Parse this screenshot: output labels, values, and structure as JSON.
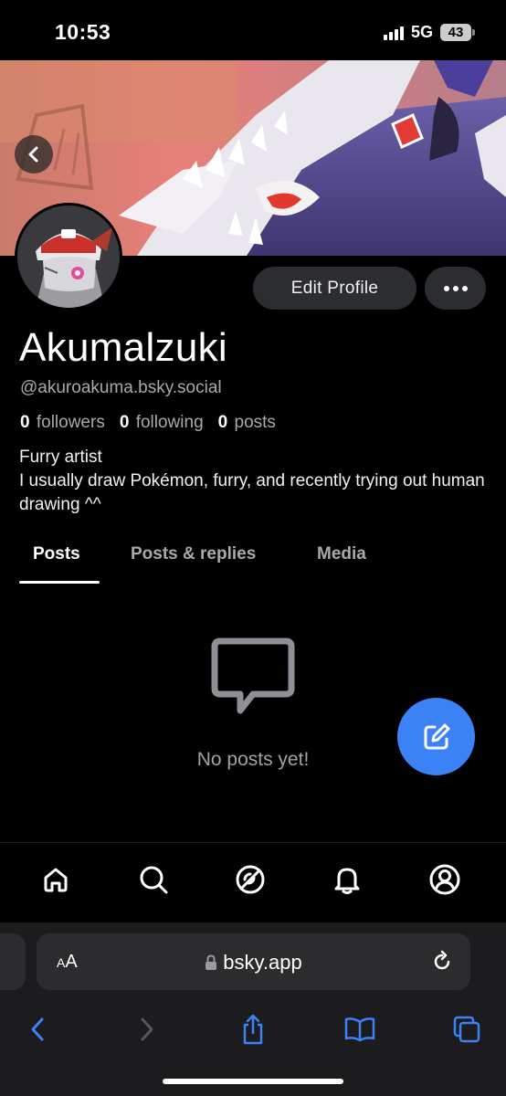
{
  "status_bar": {
    "time": "10:53",
    "network": "5G",
    "battery": "43"
  },
  "profile": {
    "display_name": "Akumalzuki",
    "handle": "@akuroakuma.bsky.social",
    "followers_count": "0",
    "followers_label": "followers",
    "following_count": "0",
    "following_label": "following",
    "posts_count": "0",
    "posts_label": "posts",
    "bio_line1": "Furry artist",
    "bio_line2": "I usually draw Pokémon, furry, and recently trying out human drawing ^^",
    "edit_profile_label": "Edit Profile"
  },
  "tabs": [
    {
      "label": "Posts",
      "active": true
    },
    {
      "label": "Posts & replies",
      "active": false
    },
    {
      "label": "Media",
      "active": false
    }
  ],
  "empty_state": {
    "message": "No posts yet!",
    "icon": "chat-bubble-icon"
  },
  "bottom_nav": [
    "home-icon",
    "search-icon",
    "feeds-icon",
    "notifications-icon",
    "profile-icon"
  ],
  "browser": {
    "text_size_label_small": "A",
    "text_size_label_large": "A",
    "url": "bsky.app",
    "accent": "#3b82f6"
  },
  "colors": {
    "accent": "#3b82f6",
    "background": "#000000",
    "muted_text": "#a7a9ad"
  }
}
